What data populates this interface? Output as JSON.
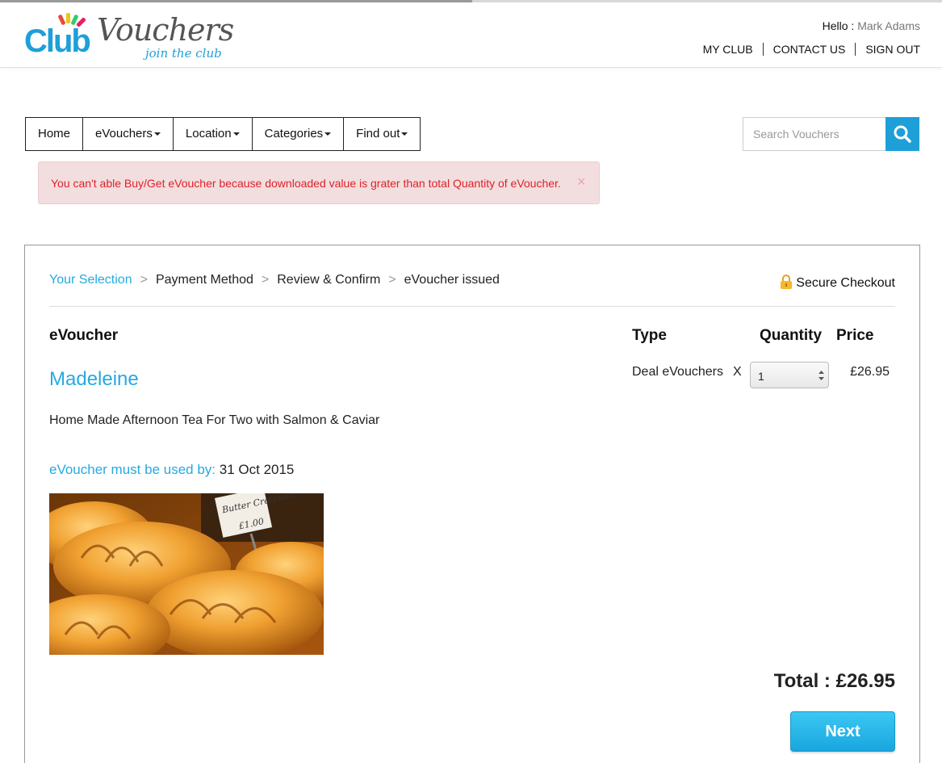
{
  "brand": {
    "logo_main": "Club",
    "logo_script": "Vouchers",
    "tagline": "join the club"
  },
  "header": {
    "greeting": "Hello :",
    "user_name": "Mark Adams",
    "links": [
      "MY CLUB",
      "CONTACT US",
      "SIGN OUT"
    ]
  },
  "nav": {
    "items": [
      "Home",
      "eVouchers",
      "Location",
      "Categories",
      "Find out"
    ]
  },
  "search": {
    "placeholder": "Search Vouchers"
  },
  "alert": {
    "message": "You can't able Buy/Get eVoucher because downloaded value is grater than total Quantity of eVoucher.",
    "close": "×"
  },
  "steps": [
    "Your Selection",
    "Payment Method",
    "Review & Confirm",
    "eVoucher issued"
  ],
  "step_separator": ">",
  "secure_checkout": "Secure Checkout",
  "columns": {
    "evoucher": "eVoucher",
    "type": "Type",
    "quantity": "Quantity",
    "price": "Price"
  },
  "voucher": {
    "name": "Madeleine",
    "description": "Home Made Afternoon Tea For Two with Salmon & Caviar",
    "expiry_label": "eVoucher must be used by:",
    "expiry_date": "31 Oct 2015",
    "type": "Deal eVouchers",
    "multiplier": "X",
    "quantity": "1",
    "price": "£26.95",
    "image_signs": [
      "Butter Croissant",
      "£1.00"
    ]
  },
  "total": "Total : £26.95",
  "next_button": "Next",
  "colors": {
    "accent": "#1e9fd8",
    "link": "#26a9e0",
    "alert_bg": "#f2dede",
    "alert_text": "#e0202a"
  }
}
